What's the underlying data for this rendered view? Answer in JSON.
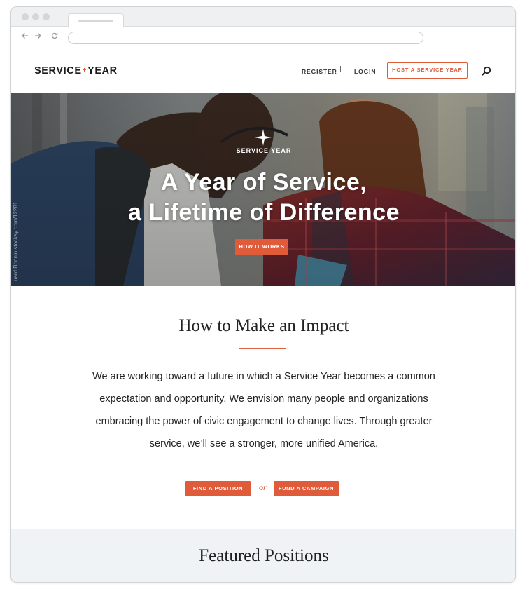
{
  "site": {
    "logo_left": "SERVICE",
    "logo_plus": "+",
    "logo_right": "YEAR"
  },
  "nav": {
    "register": "REGISTER",
    "separator": "|",
    "login": "LOGIN",
    "host": "HOST A SERVICE YEAR",
    "search_icon": "search-icon"
  },
  "hero": {
    "brand": "SERVICE YEAR",
    "title_line1": "A Year of Service,",
    "title_line2": "a Lifetime of Difference",
    "cta": "HOW IT WORKS",
    "credit": "uard Bonnin  stocksy.com/12281"
  },
  "impact": {
    "heading": "How to Make an Impact",
    "body": "We are working toward a future in which a Service Year becomes a common expectation and opportunity. We envision many people and organizations embracing the power of civic engagement to change lives. Through greater service, we’ll see a stronger, more unified America.",
    "btn_find": "FIND A POSITION",
    "or": "or",
    "btn_fund": "FUND A CAMPAIGN"
  },
  "featured": {
    "heading": "Featured Positions"
  },
  "colors": {
    "accent": "#e05b3a",
    "featured_bg": "#f0f3f5"
  }
}
